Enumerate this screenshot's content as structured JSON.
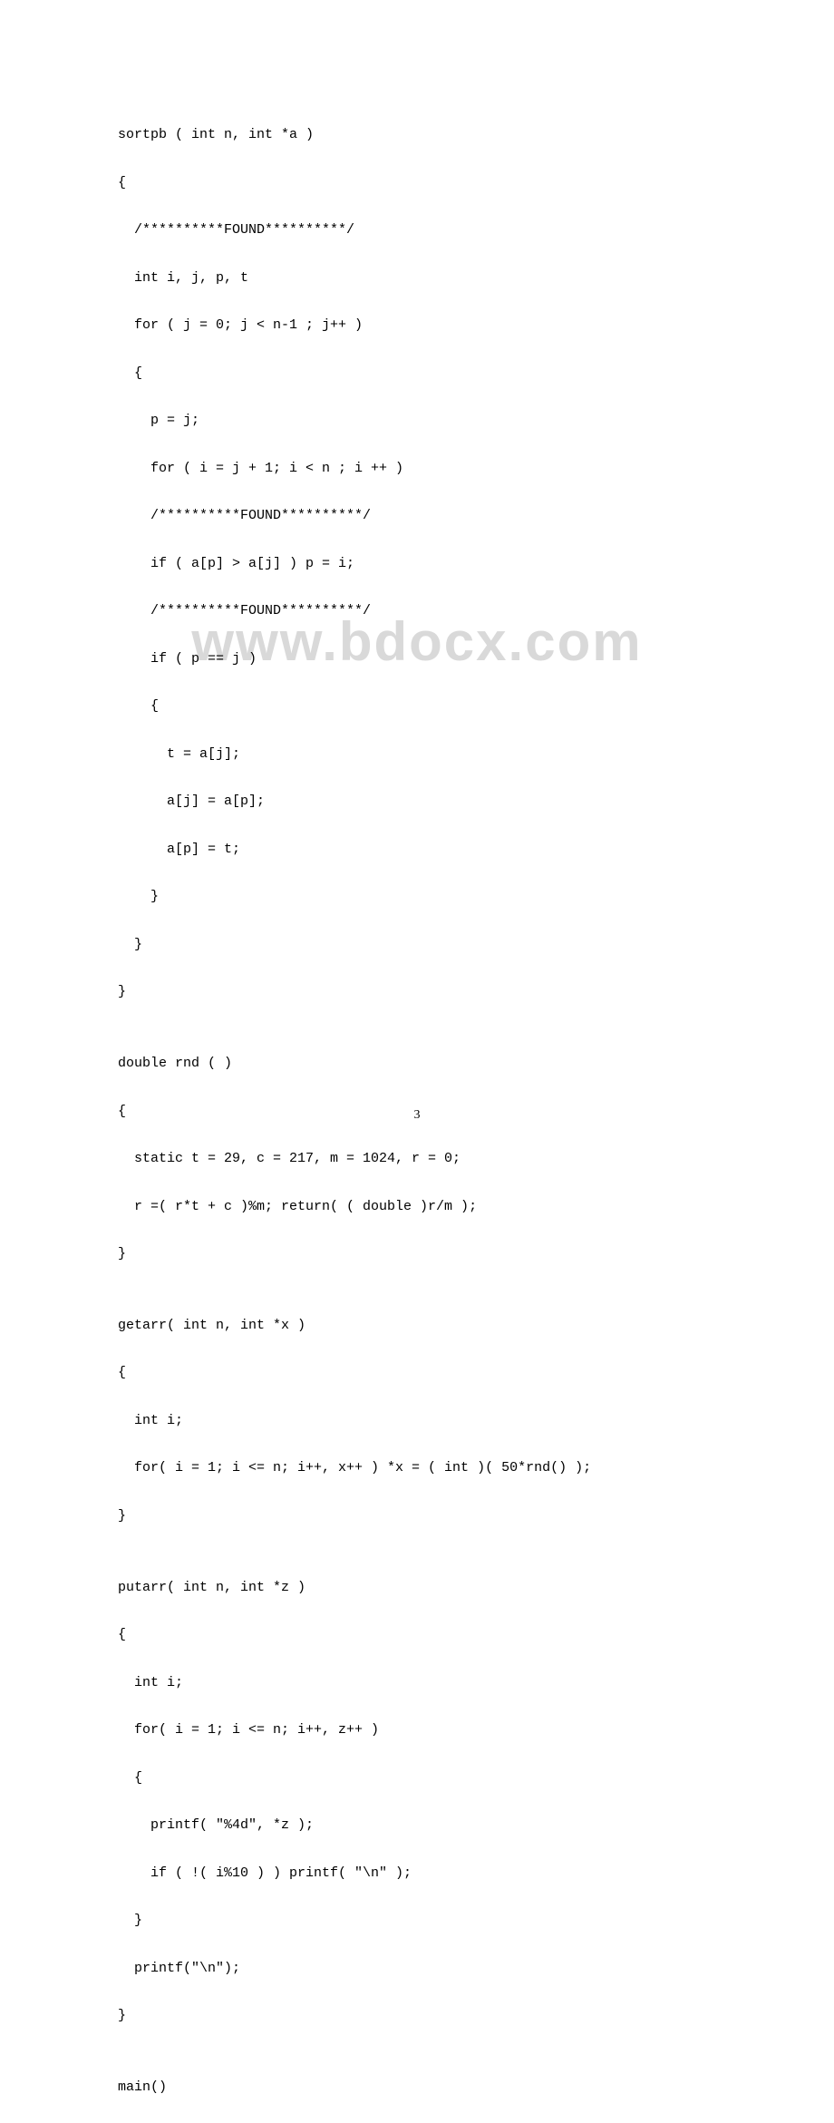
{
  "watermark": "www.bdocx.com",
  "page_number": "3",
  "code_lines": [
    "sortpb ( int n, int *a )",
    "{",
    "  /**********FOUND**********/",
    "  int i, j, p, t",
    "  for ( j = 0; j < n-1 ; j++ )",
    "  {",
    "    p = j;",
    "    for ( i = j + 1; i < n ; i ++ )",
    "    /**********FOUND**********/",
    "    if ( a[p] > a[j] ) p = i;",
    "    /**********FOUND**********/",
    "    if ( p == j )",
    "    {",
    "      t = a[j];",
    "      a[j] = a[p];",
    "      a[p] = t;",
    "    }",
    "  }",
    "}",
    "",
    "double rnd ( )",
    "{",
    "  static t = 29, c = 217, m = 1024, r = 0;",
    "  r =( r*t + c )%m; return( ( double )r/m );",
    "}",
    "",
    "getarr( int n, int *x )",
    "{",
    "  int i;",
    "  for( i = 1; i <= n; i++, x++ ) *x = ( int )( 50*rnd() );",
    "}",
    "",
    "putarr( int n, int *z )",
    "{",
    "  int i;",
    "  for( i = 1; i <= n; i++, z++ )",
    "  {",
    "    printf( \"%4d\", *z );",
    "    if ( !( i%10 ) ) printf( \"\\n\" );",
    "  }",
    "  printf(\"\\n\");",
    "}",
    "",
    "main()"
  ]
}
